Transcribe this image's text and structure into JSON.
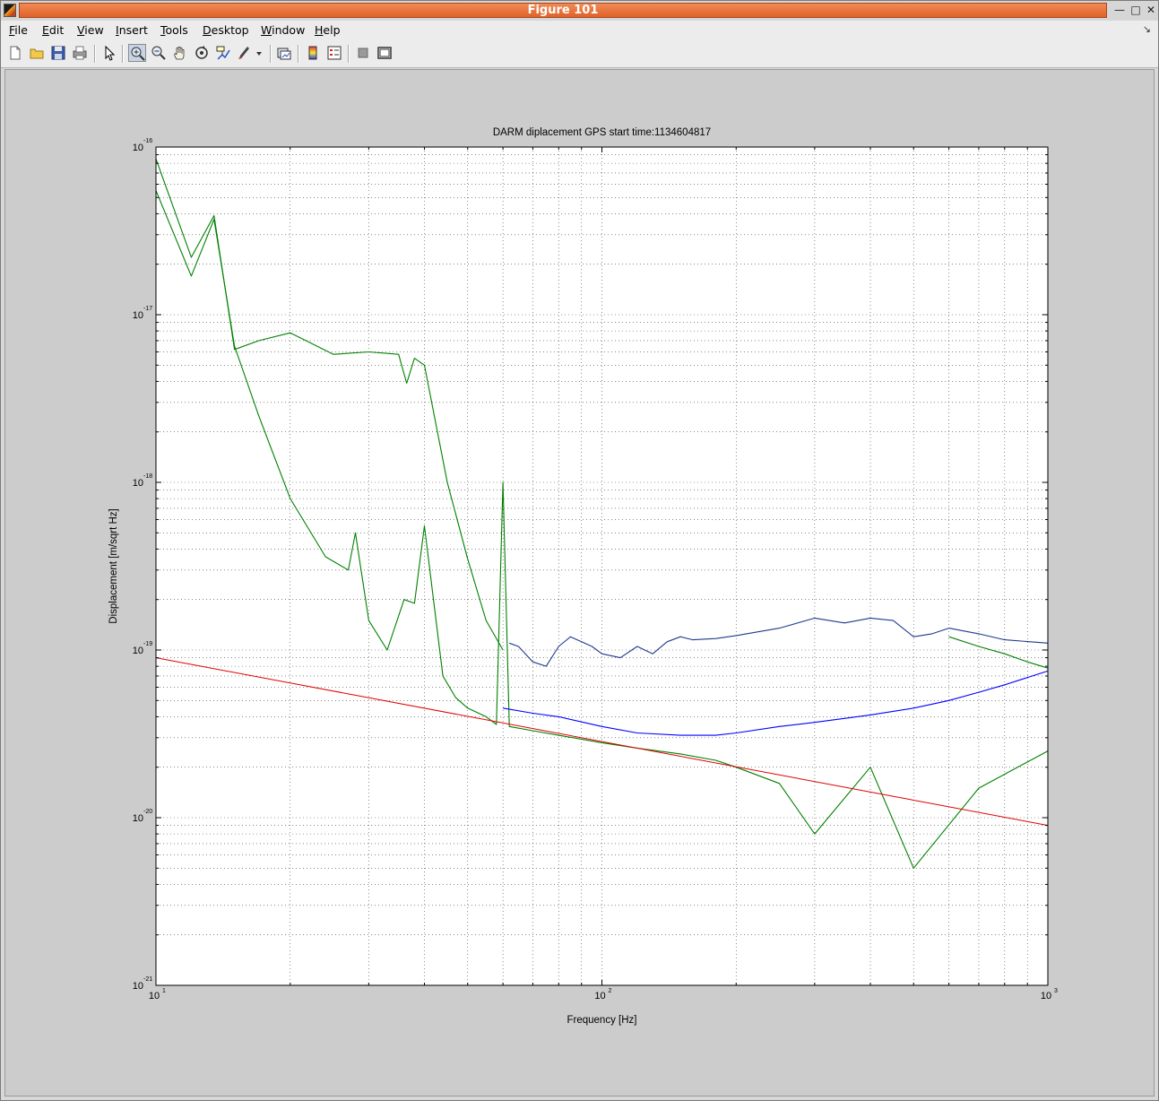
{
  "window": {
    "title": "Figure 101"
  },
  "menu": {
    "items": [
      {
        "mnemonic": "F",
        "rest": "ile"
      },
      {
        "mnemonic": "E",
        "rest": "dit"
      },
      {
        "mnemonic": "V",
        "rest": "iew"
      },
      {
        "mnemonic": "I",
        "rest": "nsert"
      },
      {
        "mnemonic": "T",
        "rest": "ools"
      },
      {
        "mnemonic": "D",
        "rest": "esktop"
      },
      {
        "mnemonic": "W",
        "rest": "indow"
      },
      {
        "mnemonic": "H",
        "rest": "elp"
      }
    ]
  },
  "toolbar": {
    "buttons": [
      "new-figure-icon",
      "open-file-icon",
      "save-icon",
      "print-icon",
      "edit-plot-arrow-icon",
      "zoom-in-icon",
      "zoom-out-icon",
      "pan-hand-icon",
      "rotate-3d-icon",
      "data-cursor-icon",
      "brush-icon",
      "brush-dropdown-icon",
      "link-plot-icon",
      "insert-colorbar-icon",
      "insert-legend-icon",
      "hide-plot-tools-icon",
      "show-plot-tools-icon"
    ],
    "active": "zoom-in-icon"
  },
  "chart_data": {
    "type": "line",
    "title": "DARM diplacement GPS start time:1134604817",
    "xlabel": "Frequency [Hz]",
    "ylabel": "Displacement [m/sqrt Hz]",
    "xscale": "log",
    "yscale": "log",
    "xlim": [
      10,
      1000
    ],
    "ylim": [
      1e-21,
      1e-16
    ],
    "grid": true,
    "x_ticks": [
      {
        "base": "10",
        "exp": "1"
      },
      {
        "base": "10",
        "exp": "2"
      },
      {
        "base": "10",
        "exp": "3"
      }
    ],
    "y_ticks": [
      {
        "base": "10",
        "exp": "-16"
      },
      {
        "base": "10",
        "exp": "-17"
      },
      {
        "base": "10",
        "exp": "-18"
      },
      {
        "base": "10",
        "exp": "-19"
      },
      {
        "base": "10",
        "exp": "-20"
      },
      {
        "base": "10",
        "exp": "-21"
      }
    ],
    "colors": {
      "green": "#008000",
      "blue": "#0000ff",
      "navy": "#1f3a8c",
      "red": "#e00000"
    },
    "series": [
      {
        "color": "green",
        "x": [
          10,
          12,
          13.5,
          15,
          17,
          20,
          24,
          27,
          28,
          30,
          33,
          36,
          38,
          40,
          42,
          44,
          47,
          50,
          55,
          58,
          60,
          62,
          70,
          80,
          100,
          120,
          150,
          180,
          200,
          250,
          300,
          400,
          500,
          700,
          1000
        ],
        "y": [
          5.5e-17,
          1.7e-17,
          3.7e-17,
          6.5e-18,
          2.5e-18,
          8e-19,
          3.6e-19,
          3e-19,
          5e-19,
          1.5e-19,
          1e-19,
          2e-19,
          1.9e-19,
          5.5e-19,
          1.9e-19,
          7e-20,
          5.2e-20,
          4.5e-20,
          4e-20,
          3.6e-20,
          1e-18,
          3.5e-20,
          3.3e-20,
          3.1e-20,
          2.8e-20,
          2.6e-20,
          2.4e-20,
          2.2e-20,
          2e-20,
          1.6e-20,
          8e-21,
          2e-20,
          5e-21,
          1.5e-20,
          2.5e-20
        ]
      },
      {
        "color": "green",
        "x": [
          10,
          12,
          13.5,
          15,
          17,
          20,
          25,
          30,
          35,
          36.5,
          38,
          40,
          45,
          50,
          55,
          60
        ],
        "y": [
          8.5e-17,
          2.2e-17,
          3.9e-17,
          6.2e-18,
          7e-18,
          7.8e-18,
          5.8e-18,
          6e-18,
          5.8e-18,
          3.9e-18,
          5.5e-18,
          5e-18,
          1e-18,
          3.5e-19,
          1.5e-19,
          1e-19
        ]
      },
      {
        "color": "navy",
        "x": [
          62,
          65,
          70,
          75,
          80,
          85,
          90,
          95,
          100,
          110,
          120,
          130,
          140,
          150,
          160,
          180,
          200,
          250,
          300,
          350,
          400,
          450,
          500,
          550,
          600,
          700,
          800,
          1000
        ],
        "y": [
          1.1e-19,
          1.05e-19,
          8.5e-20,
          8e-20,
          1.05e-19,
          1.2e-19,
          1.12e-19,
          1.05e-19,
          9.5e-20,
          9e-20,
          1.05e-19,
          9.5e-20,
          1.12e-19,
          1.2e-19,
          1.15e-19,
          1.17e-19,
          1.22e-19,
          1.35e-19,
          1.55e-19,
          1.45e-19,
          1.55e-19,
          1.5e-19,
          1.2e-19,
          1.25e-19,
          1.35e-19,
          1.25e-19,
          1.15e-19,
          1.1e-19
        ]
      },
      {
        "color": "blue",
        "x": [
          60,
          70,
          80,
          100,
          120,
          150,
          180,
          200,
          250,
          300,
          400,
          500,
          600,
          700,
          800,
          1000
        ],
        "y": [
          4.5e-20,
          4.2e-20,
          4e-20,
          3.5e-20,
          3.2e-20,
          3.1e-20,
          3.1e-20,
          3.2e-20,
          3.5e-20,
          3.7e-20,
          4.1e-20,
          4.5e-20,
          5e-20,
          5.6e-20,
          6.2e-20,
          7.5e-20
        ]
      },
      {
        "color": "green",
        "x": [
          600,
          700,
          800,
          900,
          1000
        ],
        "y": [
          1.2e-19,
          1.05e-19,
          9.5e-20,
          8.5e-20,
          7.8e-20
        ]
      },
      {
        "color": "red",
        "x": [
          10,
          1000
        ],
        "y": [
          9e-20,
          9e-21
        ]
      }
    ]
  }
}
